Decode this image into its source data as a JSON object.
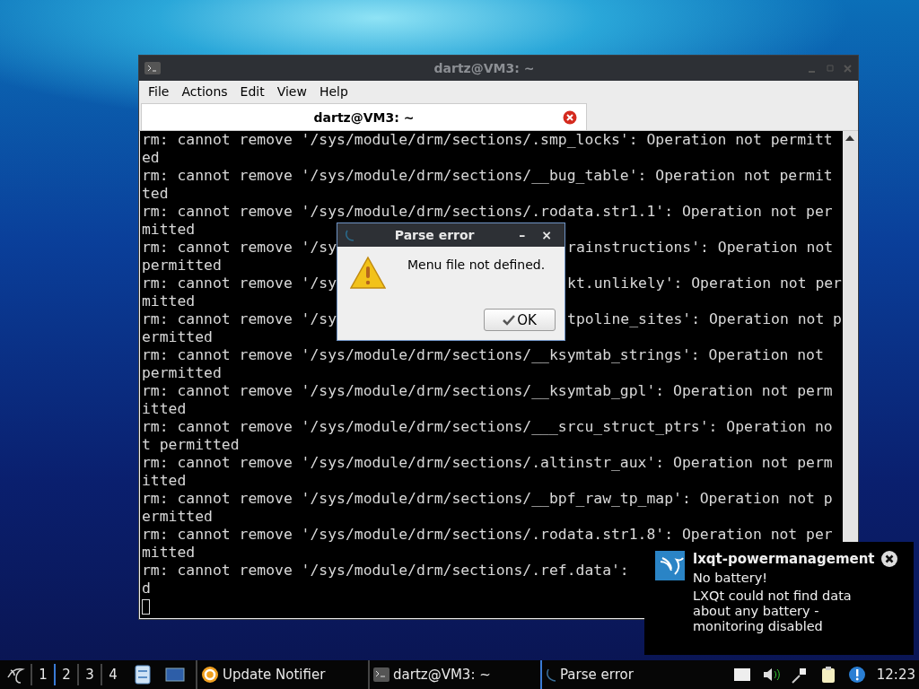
{
  "terminal_window": {
    "title": "dartz@VM3: ~",
    "menu": [
      "File",
      "Actions",
      "Edit",
      "View",
      "Help"
    ],
    "tabs": [
      {
        "label": "dartz@VM3: ~",
        "selected": true
      }
    ],
    "lines": [
      {
        "text": "rm: cannot remove '/sys/module/drm/sections/.smp_locks': Operation not permitt"
      },
      {
        "text": "ed"
      },
      {
        "text": "rm: cannot remove '/sys/module/drm/sections/__bug_table': Operation not permit"
      },
      {
        "text": "ted"
      },
      {
        "text": "rm: cannot remove '/sys/module/drm/sections/.rodata.str1.1': Operation not per"
      },
      {
        "text": "mitted"
      },
      {
        "text": "rm: cannot remove '/sy",
        "text_after": "rainstructions': Operation not "
      },
      {
        "text": "permitted"
      },
      {
        "text": "rm: cannot remove '/sy",
        "text_after": "kt.unlikely': Operation not per"
      },
      {
        "text": "mitted"
      },
      {
        "text": "rm: cannot remove '/sy",
        "text_after": "tpoline_sites': Operation not p"
      },
      {
        "text": "ermitted"
      },
      {
        "text": "rm: cannot remove '/sys/module/drm/sections/__ksymtab_strings': Operation not "
      },
      {
        "text": "permitted"
      },
      {
        "text": "rm: cannot remove '/sys/module/drm/sections/__ksymtab_gpl': Operation not perm"
      },
      {
        "text": "itted"
      },
      {
        "text": "rm: cannot remove '/sys/module/drm/sections/___srcu_struct_ptrs': Operation no"
      },
      {
        "text": "t permitted"
      },
      {
        "text": "rm: cannot remove '/sys/module/drm/sections/.altinstr_aux': Operation not perm"
      },
      {
        "text": "itted"
      },
      {
        "text": "rm: cannot remove '/sys/module/drm/sections/__bpf_raw_tp_map': Operation not p"
      },
      {
        "text": "ermitted"
      },
      {
        "text": "rm: cannot remove '/sys/module/drm/sections/.rodata.str1.8': Operation not per"
      },
      {
        "text": "mitted"
      },
      {
        "text": "rm: cannot remove '/sys/module/drm/sections/.ref.data':"
      },
      {
        "text": "d"
      }
    ]
  },
  "dialog": {
    "title": "Parse error",
    "minimize": "–",
    "close": "×",
    "message": "Menu file not defined.",
    "button": "OK"
  },
  "notification": {
    "app": "lxqt-powermanagement",
    "summary": "No battery!",
    "body": "LXQt could not find data about any battery - monitoring disabled"
  },
  "taskbar": {
    "desktops": [
      {
        "label": "1",
        "selected": false
      },
      {
        "label": "2",
        "selected": true
      },
      {
        "label": "3",
        "selected": false
      },
      {
        "label": "4",
        "selected": false
      }
    ],
    "tasks": [
      {
        "kind": "updater",
        "label": "Update Notifier",
        "selected": false
      },
      {
        "kind": "terminal",
        "label": "dartz@VM3: ~",
        "selected": false
      },
      {
        "kind": "dialog",
        "label": "Parse error",
        "selected": true
      }
    ],
    "clock": "12:23"
  }
}
